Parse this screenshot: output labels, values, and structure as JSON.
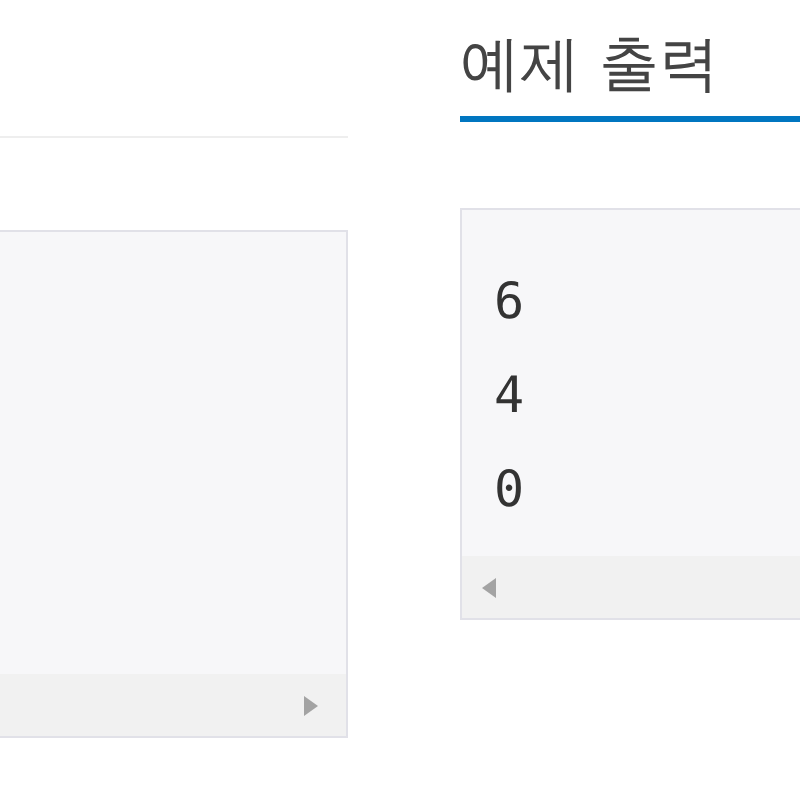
{
  "output_panel": {
    "title": "예제 출력",
    "lines": [
      "6",
      "4",
      "0"
    ]
  }
}
